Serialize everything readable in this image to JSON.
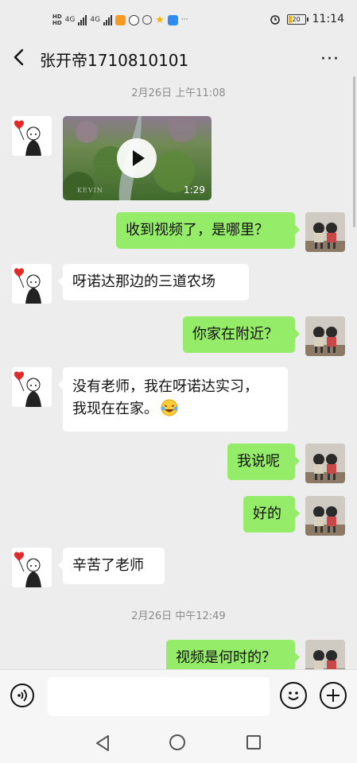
{
  "status_bar": {
    "hd1": "HD",
    "hd2": "HD",
    "net1": "4G",
    "net2": "4G",
    "icons": [
      "hd-icon",
      "signal-icon",
      "signal-icon",
      "mail-icon",
      "app-icon",
      "hotspot-icon",
      "star-icon",
      "telegram-icon"
    ],
    "more": "···",
    "battery": "20",
    "time": "11:14"
  },
  "header": {
    "title": "张开帝1710810101",
    "more": "···"
  },
  "chat": {
    "timestamps": [
      "2月26日 上午11:08",
      "2月26日 中午12:49"
    ],
    "video": {
      "duration": "1:29",
      "watermark": "KEVIN"
    },
    "messages": [
      {
        "side": "right",
        "text": "收到视频了，是哪里？"
      },
      {
        "side": "left",
        "text": "呀诺达那边的三道农场"
      },
      {
        "side": "right",
        "text": "你家在附近？"
      },
      {
        "side": "left",
        "line1": "没有老师，我在呀诺达实习，",
        "line2": "我现在在家。"
      },
      {
        "side": "right",
        "text": "我说呢"
      },
      {
        "side": "right",
        "text": "好的"
      },
      {
        "side": "left",
        "text": "辛苦了老师"
      },
      {
        "side": "right",
        "text": "视频是何时的？"
      }
    ]
  },
  "colors": {
    "background": "#ededed",
    "bubble_mine": "#95ec69",
    "bubble_theirs": "#ffffff"
  }
}
